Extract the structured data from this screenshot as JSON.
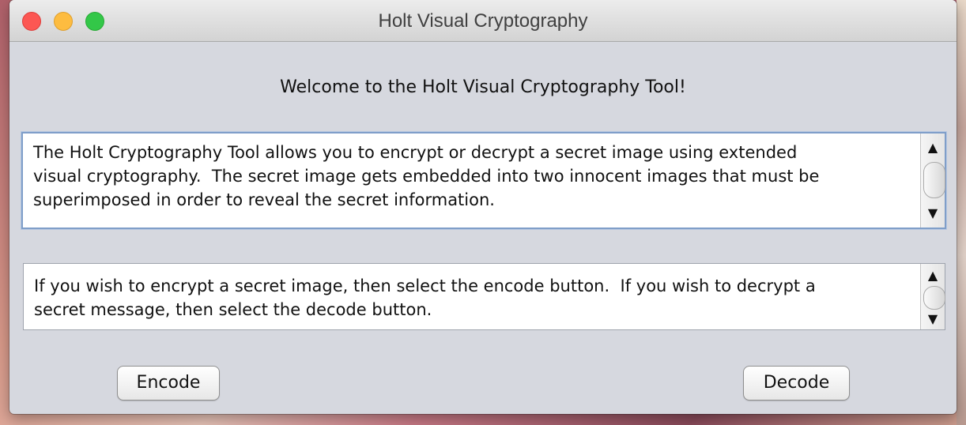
{
  "window": {
    "title": "Holt Visual Cryptography"
  },
  "main": {
    "welcome": "Welcome to the Holt Visual Cryptography Tool!",
    "description": "The Holt Cryptography Tool allows you to encrypt or decrypt a secret image using extended\nvisual cryptography.  The secret image gets embedded into two innocent images that must be\nsuperimposed in order to reveal the secret information.",
    "instructions": "If you wish to encrypt a secret image, then select the encode button.  If you wish to decrypt a\nsecret message, then select the decode button."
  },
  "buttons": {
    "encode": "Encode",
    "decode": "Decode"
  },
  "colors": {
    "close": "#fc5753",
    "minimize": "#fdbc40",
    "maximize": "#33c748",
    "focus_ring": "#7f9ec9"
  }
}
